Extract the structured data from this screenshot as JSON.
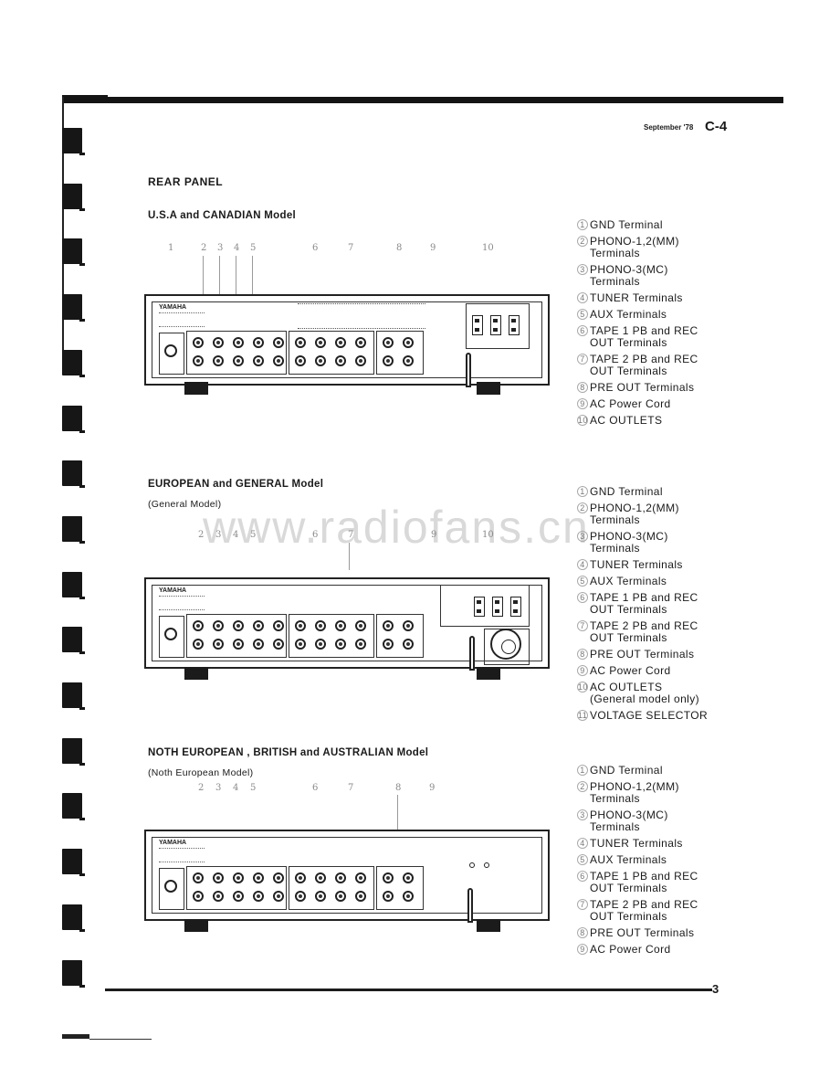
{
  "header": {
    "date": "September '78",
    "code": "C-4"
  },
  "page_title": "REAR PANEL",
  "sections": [
    {
      "title": "U.S.A and CANADIAN Model",
      "subtitle": "",
      "callouts": [
        "1",
        "2",
        "3",
        "4",
        "5",
        "6",
        "7",
        "8",
        "9",
        "10"
      ],
      "legend": [
        {
          "num": "1",
          "label": "GND Terminal"
        },
        {
          "num": "2",
          "label": "PHONO-1,2(MM)",
          "label2": "Terminals"
        },
        {
          "num": "3",
          "label": "PHONO-3(MC)",
          "label2": "Terminals"
        },
        {
          "num": "4",
          "label": "TUNER Terminals"
        },
        {
          "num": "5",
          "label": "AUX Terminals"
        },
        {
          "num": "6",
          "label": "TAPE 1 PB and REC",
          "label2": "OUT Terminals"
        },
        {
          "num": "7",
          "label": "TAPE 2 PB and REC",
          "label2": "OUT Terminals"
        },
        {
          "num": "8",
          "label": "PRE OUT Terminals"
        },
        {
          "num": "9",
          "label": "AC Power Cord"
        },
        {
          "num": "10",
          "label": "AC OUTLETS"
        }
      ]
    },
    {
      "title": "EUROPEAN and  GENERAL Model",
      "subtitle": "(General Model)",
      "callouts": [
        "2",
        "3",
        "4",
        "5",
        "6",
        "7",
        "9",
        "10"
      ],
      "legend": [
        {
          "num": "1",
          "label": "GND Terminal"
        },
        {
          "num": "2",
          "label": "PHONO-1,2(MM)",
          "label2": "Terminals"
        },
        {
          "num": "3",
          "label": "PHONO-3(MC)",
          "label2": "Terminals"
        },
        {
          "num": "4",
          "label": "TUNER Terminals"
        },
        {
          "num": "5",
          "label": "AUX Terminals"
        },
        {
          "num": "6",
          "label": "TAPE 1 PB and REC",
          "label2": "OUT Terminals"
        },
        {
          "num": "7",
          "label": "TAPE 2 PB and REC",
          "label2": "OUT Terminals"
        },
        {
          "num": "8",
          "label": "PRE OUT Terminals"
        },
        {
          "num": "9",
          "label": "AC Power Cord"
        },
        {
          "num": "10",
          "label": "AC OUTLETS",
          "label2": "(General model only)"
        },
        {
          "num": "11",
          "label": "VOLTAGE SELECTOR"
        }
      ]
    },
    {
      "title": "NOTH EUROPEAN , BRITISH and AUSTRALIAN Model",
      "subtitle": "(Noth European Model)",
      "callouts": [
        "2",
        "3",
        "4",
        "5",
        "6",
        "7",
        "8",
        "9"
      ],
      "legend": [
        {
          "num": "1",
          "label": "GND Terminal"
        },
        {
          "num": "2",
          "label": "PHONO-1,2(MM)",
          "label2": "Terminals"
        },
        {
          "num": "3",
          "label": "PHONO-3(MC)",
          "label2": "Terminals"
        },
        {
          "num": "4",
          "label": "TUNER Terminals"
        },
        {
          "num": "5",
          "label": "AUX Terminals"
        },
        {
          "num": "6",
          "label": "TAPE 1 PB and REC",
          "label2": "OUT Terminals"
        },
        {
          "num": "7",
          "label": "TAPE 2 PB and REC",
          "label2": "OUT Terminals"
        },
        {
          "num": "8",
          "label": "PRE OUT Terminals"
        },
        {
          "num": "9",
          "label": "AC Power Cord"
        }
      ]
    }
  ],
  "panel": {
    "brand": "YAMAHA"
  },
  "footer": {
    "page_number": "3"
  },
  "watermark": "www.radiofans.cn"
}
